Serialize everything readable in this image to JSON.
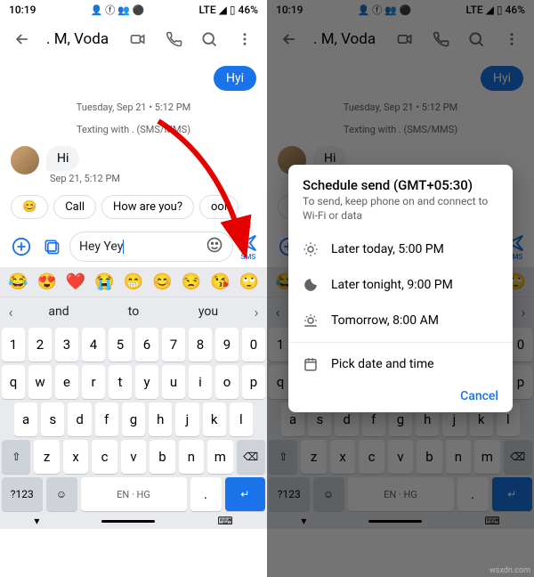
{
  "status": {
    "time": "10:19",
    "lte": "LTE",
    "signal": "◢",
    "battery_pct": "46%"
  },
  "header": {
    "title": ". M, Voda"
  },
  "chat": {
    "outgoing": "Hyi",
    "date_line": "Tuesday, Sep 21 • 5:12 PM",
    "texting_with": "Texting with . (SMS/MMS)",
    "incoming": "Hi",
    "incoming_time": "Sep 21, 5:12 PM"
  },
  "suggestions_chips": {
    "emoji": "😊",
    "c1": "Call",
    "c2": "How are you?",
    "c3": "ool"
  },
  "composer": {
    "text": "Hey Yey",
    "send_label": "SMS"
  },
  "emoji_row": [
    "😂",
    "😍",
    "❤️",
    "😭",
    "😁",
    "😊",
    "😒",
    "😘",
    "🙄"
  ],
  "predictions": {
    "p1": "and",
    "p2": "to",
    "p3": "you"
  },
  "keys": {
    "num": [
      "1",
      "2",
      "3",
      "4",
      "5",
      "6",
      "7",
      "8",
      "9",
      "0"
    ],
    "r1": [
      "q",
      "w",
      "e",
      "r",
      "t",
      "y",
      "u",
      "i",
      "o",
      "p"
    ],
    "r2": [
      "a",
      "s",
      "d",
      "f",
      "g",
      "h",
      "j",
      "k",
      "l"
    ],
    "r3": [
      "z",
      "x",
      "c",
      "v",
      "b",
      "n",
      "m"
    ],
    "shift": "⇧",
    "back": "⌫",
    "sym": "?123",
    "comma": ",",
    "space": "EN · HG",
    "dot": ".",
    "enter": "↵"
  },
  "dialog": {
    "title": "Schedule send (GMT+05:30)",
    "subtitle": "To send, keep phone on and connect to Wi-Fi or data",
    "opt1": "Later today, 5:00 PM",
    "opt2": "Later tonight, 9:00 PM",
    "opt3": "Tomorrow, 8:00 AM",
    "opt4": "Pick date and time",
    "cancel": "Cancel"
  },
  "watermark": "wsxdn.com"
}
